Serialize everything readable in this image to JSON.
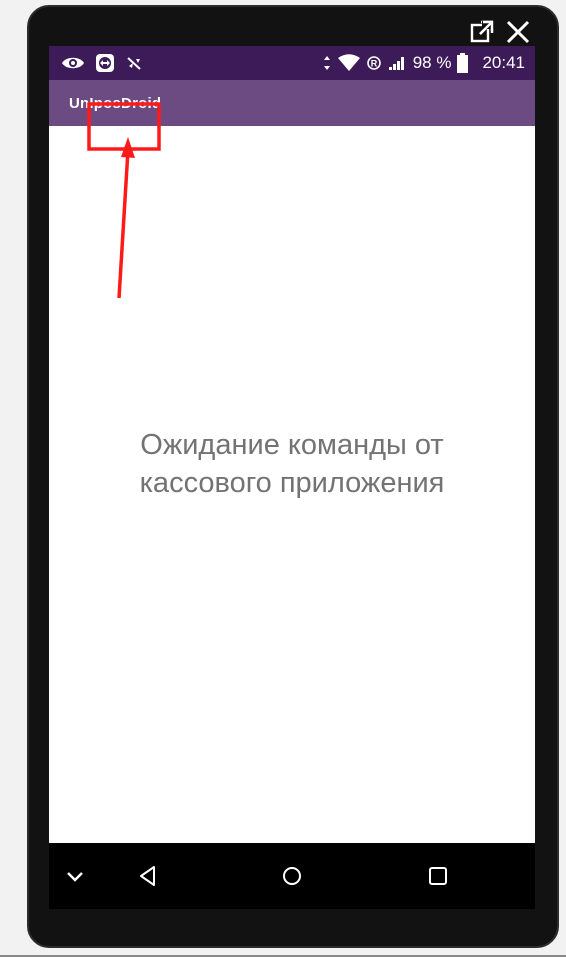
{
  "status_bar": {
    "battery_percent": "98 %",
    "time": "20:41",
    "icons_left": [
      "eye-icon",
      "teamviewer-icon",
      "no-signal-icon"
    ],
    "icons_right": [
      "data-arrows-icon",
      "wifi-icon",
      "roaming-icon",
      "cell-signal-icon",
      "battery-icon"
    ]
  },
  "app_bar": {
    "title": "UnIposDroid"
  },
  "content": {
    "message_line1": "Ожидание команды от",
    "message_line2": "кассового приложения"
  },
  "window_controls": {
    "icons": [
      "external-open-icon",
      "close-icon"
    ]
  },
  "nav_bar": {
    "icons": [
      "chevron-down-icon",
      "back-icon",
      "home-icon",
      "recents-icon"
    ]
  },
  "colors": {
    "status_bar": "#3d1a58",
    "app_bar": "#6c4a82",
    "annotation": "#ff1a1a",
    "text": "#737373"
  }
}
